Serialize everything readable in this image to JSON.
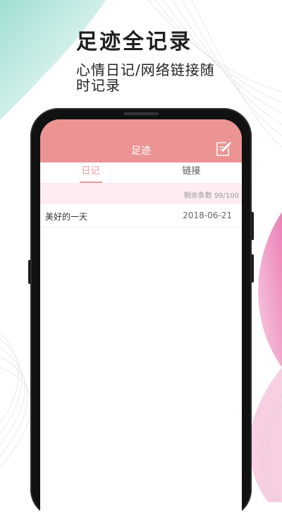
{
  "promo": {
    "headline": "足迹全记录",
    "subline": "心情日记/网络链接随时记录"
  },
  "app": {
    "title": "足迹",
    "edit_icon": "edit-note-icon",
    "accent_color": "#ec9393"
  },
  "tabs": [
    {
      "label": "日记",
      "active": true
    },
    {
      "label": "链接",
      "active": false
    }
  ],
  "status": {
    "remaining": "剩余条数 99/100"
  },
  "diary": [
    {
      "title": "美好的一天",
      "date": "2018-06-21"
    }
  ]
}
